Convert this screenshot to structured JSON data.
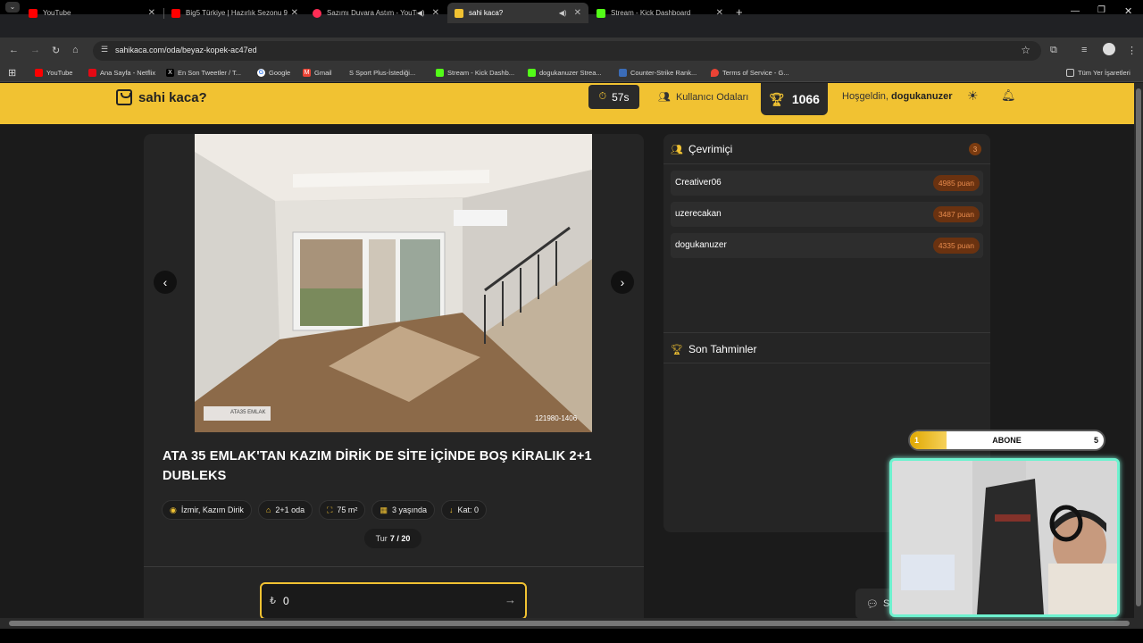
{
  "browser": {
    "tabs": [
      {
        "label": "YouTube",
        "color": "#ff0000",
        "active": false
      },
      {
        "label": "Big5 Türkiye | Hazırlık Sezonu 9",
        "color": "#ff0000",
        "active": false
      },
      {
        "label": "Sazımı Duvara Astım - YouTube",
        "color": "#ff2d55",
        "active": false
      },
      {
        "label": "sahi kaca?",
        "color": "#f1c232",
        "active": true
      },
      {
        "label": "Stream - Kick Dashboard",
        "color": "#53fc18",
        "active": false
      }
    ],
    "new_tab": "+",
    "url": "sahikaca.com/oda/beyaz-kopek-ac47ed",
    "bookmarks": [
      {
        "label": "YouTube",
        "color": "#ff0000"
      },
      {
        "label": "Ana Sayfa - Netflix",
        "color": "#e50914"
      },
      {
        "label": "En Son Tweetler / T...",
        "color": "#000000"
      },
      {
        "label": "Google",
        "color": "#4285f4"
      },
      {
        "label": "Gmail",
        "color": "#ea4335"
      },
      {
        "label": "S Sport Plus-İstediği...",
        "color": "#222222"
      },
      {
        "label": "Stream - Kick Dashb...",
        "color": "#53fc18"
      },
      {
        "label": "dogukanuzer Strea...",
        "color": "#53fc18"
      },
      {
        "label": "Counter-Strike Rank...",
        "color": "#3b6cb7"
      },
      {
        "label": "Terms of Service - G...",
        "color": "#ea4335"
      }
    ],
    "all_bookmarks": "Tüm Yer İşaretleri"
  },
  "header": {
    "logo": "sahi kaca?",
    "timer": "57s",
    "rooms": "Kullanıcı Odaları",
    "score": "1066",
    "welcome_prefix": "Hoşgeldin,",
    "username": "dogukanuzer",
    "accent": "#f1c232"
  },
  "listing": {
    "watermark_logo": "ATA35 EMLAK",
    "photo_id": "121980-1406",
    "title": "ATA 35 EMLAK'TAN KAZIM DİRİK DE SİTE İÇİNDE BOŞ KİRALIK 2+1 DUBLEKS",
    "chips": [
      {
        "icon": "location-icon",
        "label": "İzmir, Kazım Dirik"
      },
      {
        "icon": "home-icon",
        "label": "2+1 oda"
      },
      {
        "icon": "area-icon",
        "label": "75 m²"
      },
      {
        "icon": "building-icon",
        "label": "3 yaşında"
      },
      {
        "icon": "floor-icon",
        "label": "Kat: 0"
      }
    ],
    "round_label": "Tur",
    "round_value": "7 / 20",
    "currency": "₺",
    "guess_value": "0"
  },
  "online": {
    "title": "Çevrimiçi",
    "count": "3",
    "players": [
      {
        "name": "Creativer06",
        "points": "4985 puan"
      },
      {
        "name": "uzerecakan",
        "points": "3487 puan"
      },
      {
        "name": "dogukanuzer",
        "points": "4335 puan"
      }
    ]
  },
  "recent": {
    "title": "Son Tahminler"
  },
  "chat": {
    "label": "S"
  },
  "overlay": {
    "sub_left": "1",
    "sub_label": "ABONE",
    "sub_right": "5",
    "sub_progress": 0.19
  }
}
